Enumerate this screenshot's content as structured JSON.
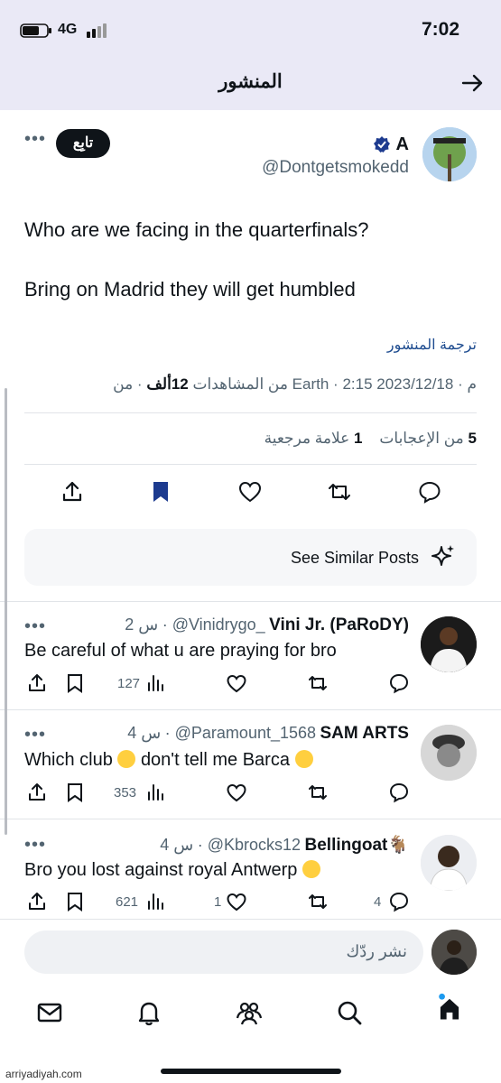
{
  "status_bar": {
    "time": "7:02",
    "network": "4G"
  },
  "header": {
    "title": "المنشور"
  },
  "post": {
    "author_name": "A",
    "author_handle": "@Dontgetsmokedd",
    "follow_label": "تابِع",
    "text_line1": "Who are we facing in the quarterfinals?",
    "text_line2": "Bring on Madrid they will get humbled",
    "translate_label": "ترجمة المنشور",
    "date": "2023/12/18",
    "time": "2:15 م",
    "location": "من Earth",
    "views_count": "12ألف",
    "views_label": "من المشاهدات",
    "likes_count": "5",
    "likes_label": "من الإعجابات",
    "bookmarks_count": "1",
    "bookmarks_label": "علامة مرجعية"
  },
  "see_similar": {
    "label": "See Similar Posts"
  },
  "replies": [
    {
      "name": "Vini Jr. (PaRoDY)",
      "handle": "@Vinidrygo_",
      "time": "2 س",
      "text": "Be careful of what u are praying for bro",
      "views": "127",
      "likes": "",
      "replies": ""
    },
    {
      "name": "SAM ARTS",
      "handle": "@Paramount_1568",
      "time": "4 س",
      "text_part1": "Which club",
      "text_part2": "don't tell me Barca",
      "views": "353",
      "likes": "",
      "replies": ""
    },
    {
      "name": "Bellingoat🐐",
      "handle": "@Kbrocks12",
      "time": "4 س",
      "text": "Bro you lost against royal Antwerp",
      "views": "621",
      "likes": "1",
      "replies": "4"
    }
  ],
  "composer": {
    "placeholder": "نشر ردّك"
  },
  "watermark": "arriyadiyah.com",
  "colors": {
    "accent": "#1d9bf0",
    "text": "#0f1419",
    "muted": "#536471",
    "header_bg": "#eae9f6"
  }
}
